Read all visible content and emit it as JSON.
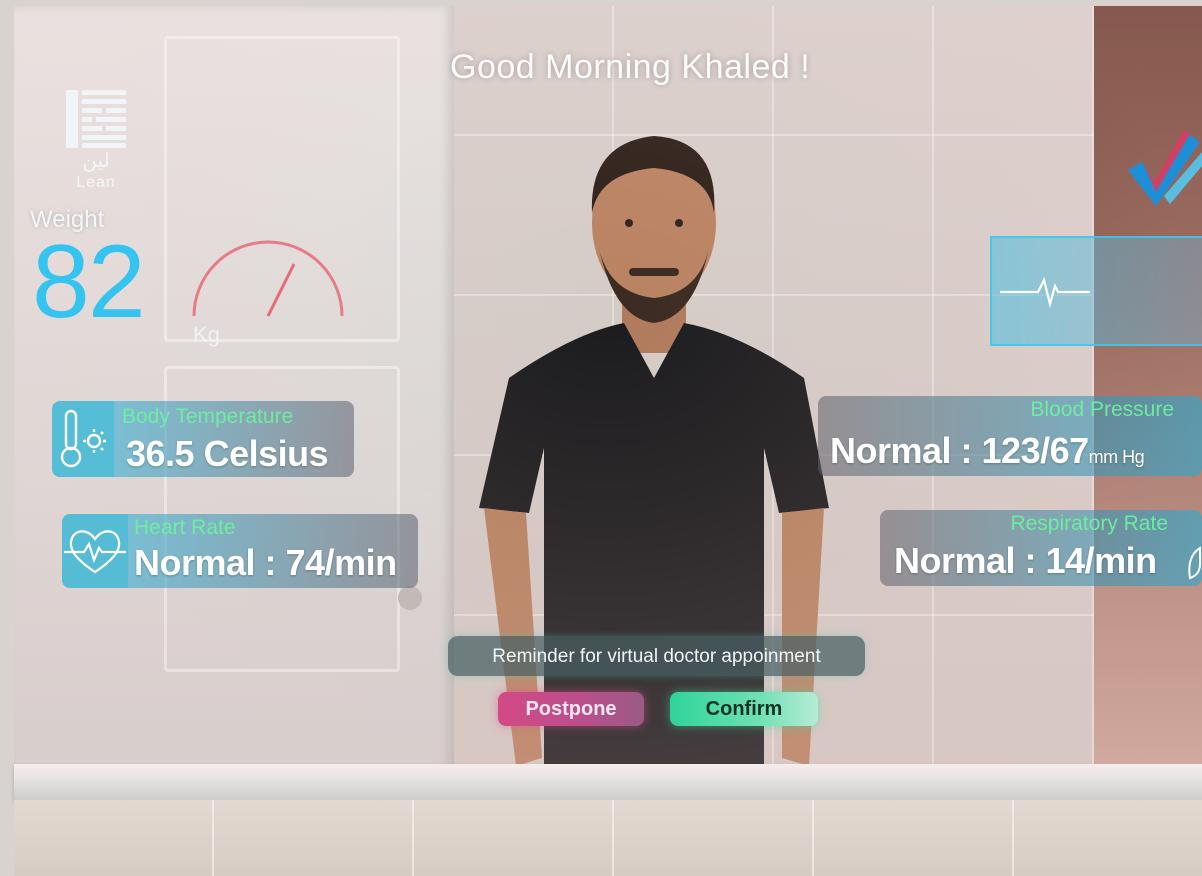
{
  "greeting": "Good Morning Khaled !",
  "logo": {
    "arabic": "لين",
    "latin": "Lean"
  },
  "weight": {
    "label": "Weight",
    "value": "82",
    "unit": "Kg"
  },
  "metrics": {
    "body_temperature": {
      "title": "Body Temperature",
      "value": "36.5 Celsius",
      "icon": "thermometer-sun-icon"
    },
    "heart_rate": {
      "title": "Heart Rate",
      "value": "Normal : 74/min",
      "icon": "heart-pulse-icon"
    },
    "blood_pressure": {
      "title": "Blood Pressure",
      "value": "Normal : 123/67",
      "unit": "mm Hg"
    },
    "respiratory_rate": {
      "title": "Respiratory Rate",
      "value": "Normal : 14/min",
      "icon": "lungs-icon"
    }
  },
  "pulse_panel": {
    "icon": "heartbeat-line-icon"
  },
  "reminder": {
    "text": "Reminder for virtual doctor appoinment",
    "postpone_label": "Postpone",
    "confirm_label": "Confirm"
  },
  "colors": {
    "accent_cyan": "#35c4ef",
    "title_green": "#6cf59d",
    "postpone_pink": "#d24a86",
    "confirm_green": "#2fd49b"
  }
}
